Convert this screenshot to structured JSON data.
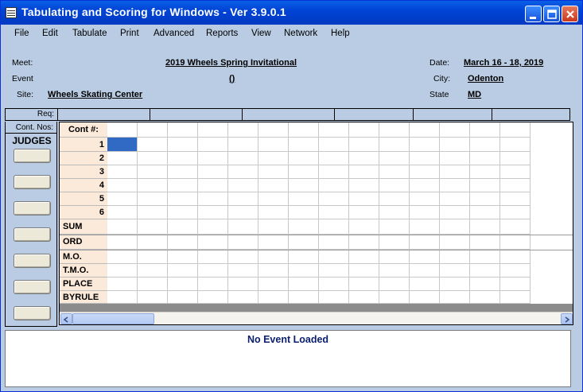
{
  "window": {
    "title": "Tabulating and Scoring for Windows - Ver 3.9.0.1"
  },
  "menu": [
    "File",
    "Edit",
    "Tabulate",
    "Print",
    "Advanced",
    "Reports",
    "View",
    "Network",
    "Help"
  ],
  "meet": {
    "meet_label": "Meet:",
    "meet_value": "2019 Wheels Spring Invitational",
    "event_label": "Event",
    "event_value": "()",
    "site_label": "Site:",
    "site_value": "Wheels Skating Center",
    "date_label": "Date:",
    "date_value": "March 16 - 18, 2019",
    "city_label": "City:",
    "city_value": "Odenton",
    "state_label": "State",
    "state_value": "MD"
  },
  "grid": {
    "req_label": "Req:",
    "cont_nos_label": "Cont. Nos:",
    "judges_label": "JUDGES",
    "cont_header": "Cont #:",
    "rows": [
      "1",
      "2",
      "3",
      "4",
      "5",
      "6",
      "SUM",
      "ORD",
      "M.O.",
      "T.M.O.",
      "PLACE",
      "BYRULE"
    ],
    "selected_cell": {
      "row": 1,
      "column": 1
    }
  },
  "status": {
    "message": "No Event Loaded"
  },
  "colors": {
    "titlebar": "#0044d6",
    "background": "#b9cce3",
    "row_label_bg": "#fbe9d9",
    "selected": "#316ac5",
    "status_text": "#0a1f6e"
  },
  "icons": [
    "app-grid-icon",
    "minimize-icon",
    "maximize-icon",
    "close-icon",
    "scroll-left-icon",
    "scroll-right-icon"
  ]
}
